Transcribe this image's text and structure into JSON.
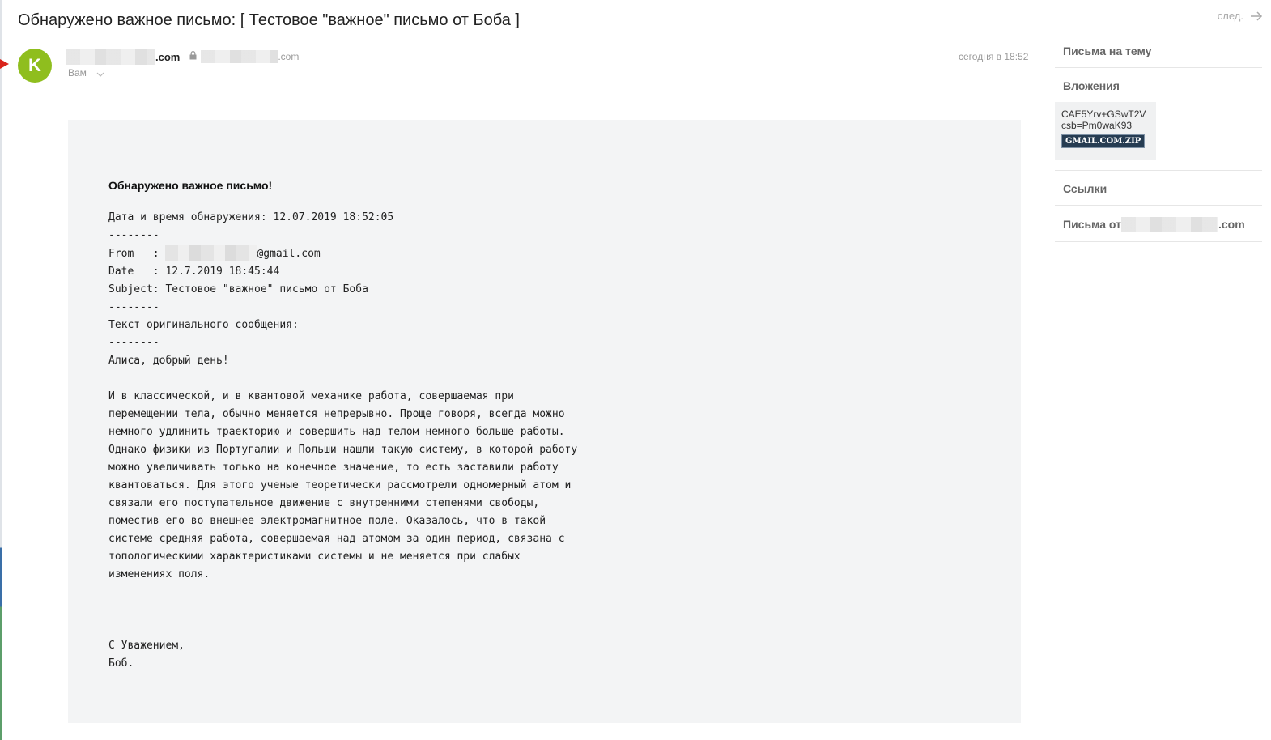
{
  "message": {
    "subject": "Обнаружено важное письмо: [ Тестовое \"важное\" письмо от Боба ]",
    "avatar_letter": "K",
    "avatar_color": "#8fbe1e",
    "sender_domain": ".com",
    "sender_email_domain": ".com",
    "recipient": "Вам",
    "date": "сегодня в 18:52"
  },
  "nav": {
    "next_label": "след."
  },
  "body": {
    "heading": "Обнаружено важное письмо!",
    "line_detect": "Дата и время обнаружения: 12.07.2019 18:52:05",
    "separator": "--------",
    "from_label": "From   : ",
    "from_domain": "@gmail.com",
    "date_line": "Date   : 12.7.2019 18:45:44",
    "subject_line": "Subject: Тестовое \"важное\" письмо от Боба",
    "original_label": "Текст оригинального сообщения:",
    "greeting": "Алиса, добрый день!",
    "paragraph": "И в классической, и в квантовой механике работа, совершаемая при\nперемещении тела, обычно меняется непрерывно. Проще говоря, всегда можно\nнемного удлинить траекторию и совершить над телом немного больше работы.\nОднако физики из Португалии и Польши нашли такую систему, в которой работу\nможно увеличивать только на конечное значение, то есть заставили работу\nквантоваться. Для этого ученые теоретически рассмотрели одномерный атом и\nсвязали его поступательное движение с внутренними степенями свободы,\nпоместив его во внешнее электромагнитное поле. Оказалось, что в такой\nсистеме средняя работа, совершаемая над атомом за один период, связана с\nтопологическими характеристиками системы и не меняется при слабых\nизменениях поля.",
    "closing": "С Уважением,",
    "signature": "Боб."
  },
  "sidebar": {
    "thread_label": "Письма на тему",
    "attachments_label": "Вложения",
    "attachment": {
      "name": "CAE5Yrv+GSwT2Vcsb=Pm0waK93",
      "badge": "GMAIL.COM.ZIP"
    },
    "links_label": "Ссылки",
    "from_label": "Письма от",
    "from_domain": ".com"
  },
  "icons": {
    "next": "arrow-right-icon",
    "lock": "lock-icon",
    "recipient_toggle": "chevron-down-icon",
    "flag": "flag-marker-icon"
  }
}
